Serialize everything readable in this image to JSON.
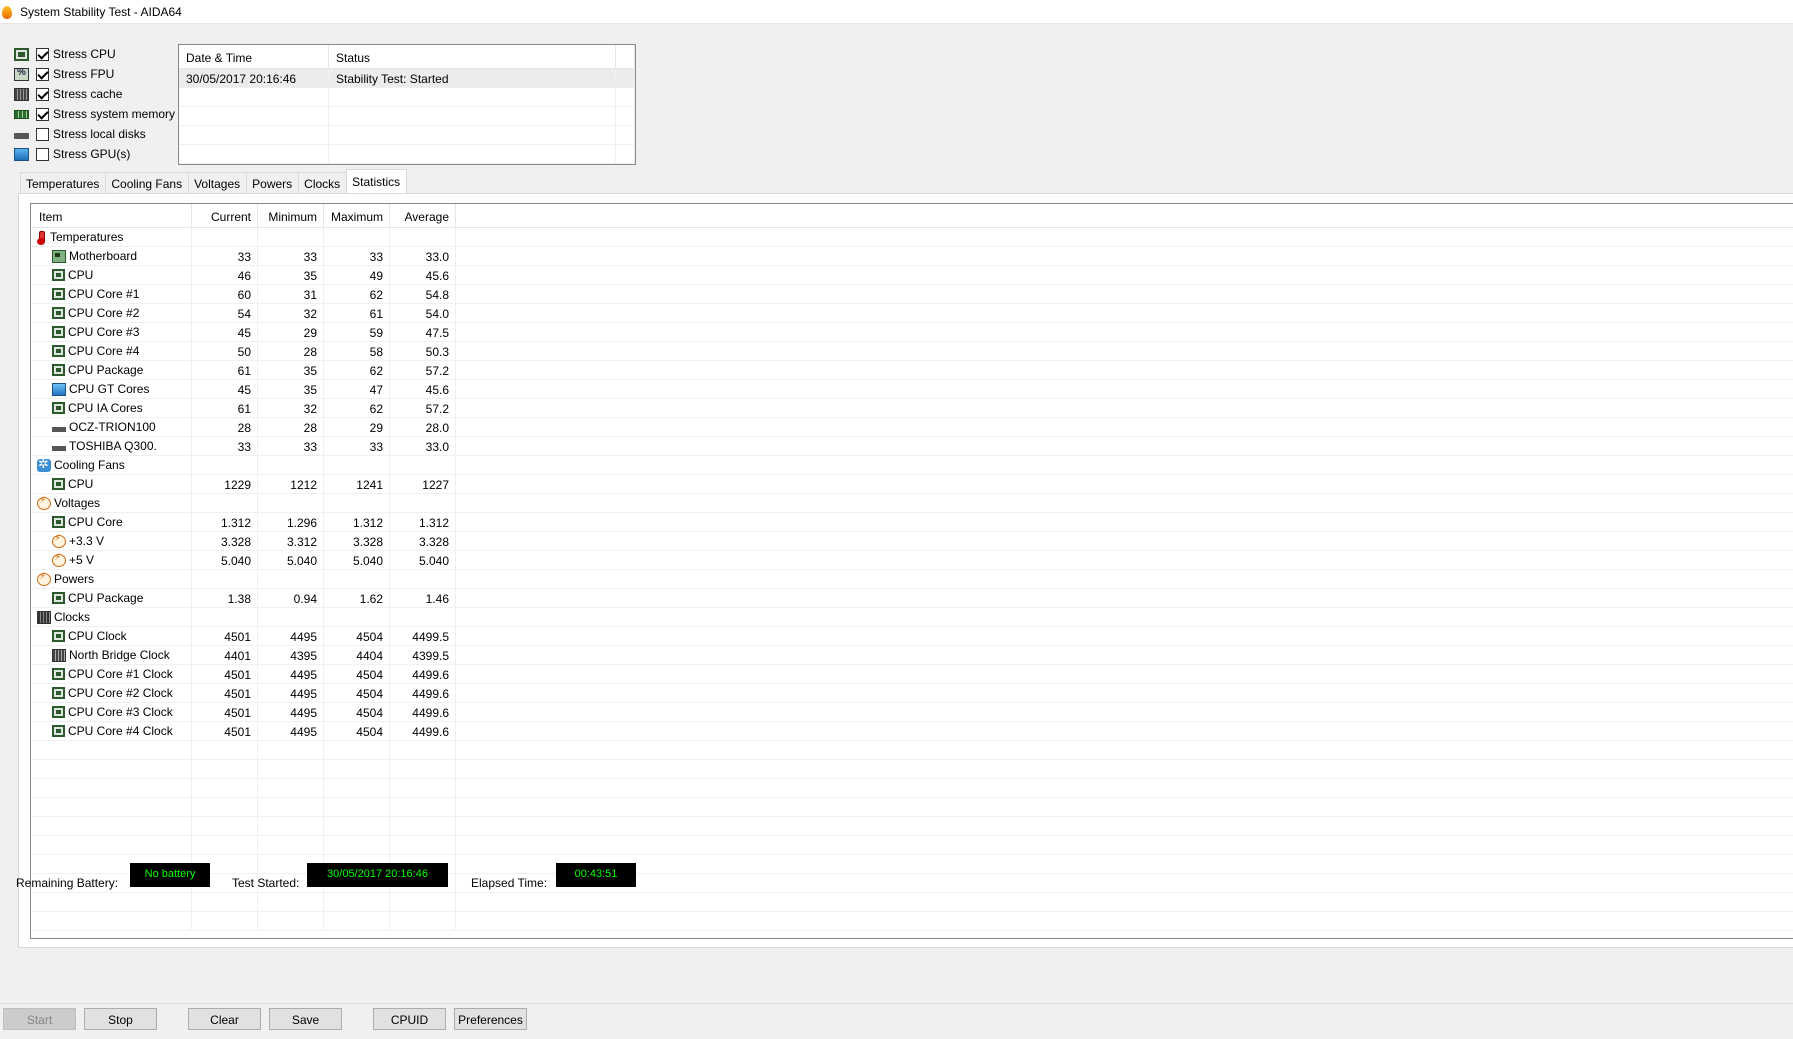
{
  "window": {
    "title": "System Stability Test - AIDA64",
    "icon": "flame-icon"
  },
  "stress": [
    {
      "label": "Stress CPU",
      "checked": true,
      "icon": "chip"
    },
    {
      "label": "Stress FPU",
      "checked": true,
      "icon": "fpu"
    },
    {
      "label": "Stress cache",
      "checked": true,
      "icon": "cache"
    },
    {
      "label": "Stress system memory",
      "checked": true,
      "icon": "mem"
    },
    {
      "label": "Stress local disks",
      "checked": false,
      "icon": "disk"
    },
    {
      "label": "Stress GPU(s)",
      "checked": false,
      "icon": "gpu"
    }
  ],
  "log": {
    "headers": {
      "datetime": "Date & Time",
      "status": "Status"
    },
    "rows": [
      {
        "datetime": "30/05/2017 20:16:46",
        "status": "Stability Test: Started"
      }
    ]
  },
  "tabs": [
    "Temperatures",
    "Cooling Fans",
    "Voltages",
    "Powers",
    "Clocks",
    "Statistics"
  ],
  "active_tab": "Statistics",
  "stats": {
    "headers": {
      "item": "Item",
      "current": "Current",
      "minimum": "Minimum",
      "maximum": "Maximum",
      "average": "Average"
    },
    "rows": [
      {
        "type": "cat",
        "label": "Temperatures",
        "icon": "therm"
      },
      {
        "label": "Motherboard",
        "icon": "mobo",
        "cur": "33",
        "min": "33",
        "max": "33",
        "avg": "33.0"
      },
      {
        "label": "CPU",
        "icon": "chip",
        "cur": "46",
        "min": "35",
        "max": "49",
        "avg": "45.6"
      },
      {
        "label": "CPU Core #1",
        "icon": "chip",
        "cur": "60",
        "min": "31",
        "max": "62",
        "avg": "54.8"
      },
      {
        "label": "CPU Core #2",
        "icon": "chip",
        "cur": "54",
        "min": "32",
        "max": "61",
        "avg": "54.0"
      },
      {
        "label": "CPU Core #3",
        "icon": "chip",
        "cur": "45",
        "min": "29",
        "max": "59",
        "avg": "47.5"
      },
      {
        "label": "CPU Core #4",
        "icon": "chip",
        "cur": "50",
        "min": "28",
        "max": "58",
        "avg": "50.3"
      },
      {
        "label": "CPU Package",
        "icon": "chip",
        "cur": "61",
        "min": "35",
        "max": "62",
        "avg": "57.2"
      },
      {
        "label": "CPU GT Cores",
        "icon": "gpu",
        "cur": "45",
        "min": "35",
        "max": "47",
        "avg": "45.6"
      },
      {
        "label": "CPU IA Cores",
        "icon": "chip",
        "cur": "61",
        "min": "32",
        "max": "62",
        "avg": "57.2"
      },
      {
        "label": "OCZ-TRION100",
        "icon": "disk",
        "cur": "28",
        "min": "28",
        "max": "29",
        "avg": "28.0"
      },
      {
        "label": "TOSHIBA Q300.",
        "icon": "disk",
        "cur": "33",
        "min": "33",
        "max": "33",
        "avg": "33.0"
      },
      {
        "type": "cat",
        "label": "Cooling Fans",
        "icon": "fan"
      },
      {
        "label": "CPU",
        "icon": "chip",
        "cur": "1229",
        "min": "1212",
        "max": "1241",
        "avg": "1227"
      },
      {
        "type": "cat",
        "label": "Voltages",
        "icon": "volt"
      },
      {
        "label": "CPU Core",
        "icon": "chip",
        "cur": "1.312",
        "min": "1.296",
        "max": "1.312",
        "avg": "1.312"
      },
      {
        "label": "+3.3 V",
        "icon": "volt",
        "cur": "3.328",
        "min": "3.312",
        "max": "3.328",
        "avg": "3.328"
      },
      {
        "label": "+5 V",
        "icon": "volt",
        "cur": "5.040",
        "min": "5.040",
        "max": "5.040",
        "avg": "5.040"
      },
      {
        "type": "cat",
        "label": "Powers",
        "icon": "volt"
      },
      {
        "label": "CPU Package",
        "icon": "chip",
        "cur": "1.38",
        "min": "0.94",
        "max": "1.62",
        "avg": "1.46"
      },
      {
        "type": "cat",
        "label": "Clocks",
        "icon": "clock"
      },
      {
        "label": "CPU Clock",
        "icon": "chip",
        "cur": "4501",
        "min": "4495",
        "max": "4504",
        "avg": "4499.5"
      },
      {
        "label": "North Bridge Clock",
        "icon": "nb",
        "cur": "4401",
        "min": "4395",
        "max": "4404",
        "avg": "4399.5"
      },
      {
        "label": "CPU Core #1 Clock",
        "icon": "chip",
        "cur": "4501",
        "min": "4495",
        "max": "4504",
        "avg": "4499.6"
      },
      {
        "label": "CPU Core #2 Clock",
        "icon": "chip",
        "cur": "4501",
        "min": "4495",
        "max": "4504",
        "avg": "4499.6"
      },
      {
        "label": "CPU Core #3 Clock",
        "icon": "chip",
        "cur": "4501",
        "min": "4495",
        "max": "4504",
        "avg": "4499.6"
      },
      {
        "label": "CPU Core #4 Clock",
        "icon": "chip",
        "cur": "4501",
        "min": "4495",
        "max": "4504",
        "avg": "4499.6"
      }
    ]
  },
  "status": {
    "battery_label": "Remaining Battery:",
    "battery_value": "No battery",
    "started_label": "Test Started:",
    "started_value": "30/05/2017 20:16:46",
    "elapsed_label": "Elapsed Time:",
    "elapsed_value": "00:43:51"
  },
  "buttons": {
    "start": "Start",
    "stop": "Stop",
    "clear": "Clear",
    "save": "Save",
    "cpuid": "CPUID",
    "preferences": "Preferences"
  },
  "colors": {
    "status_box_bg": "#000000",
    "status_box_text": "#00ff00"
  }
}
